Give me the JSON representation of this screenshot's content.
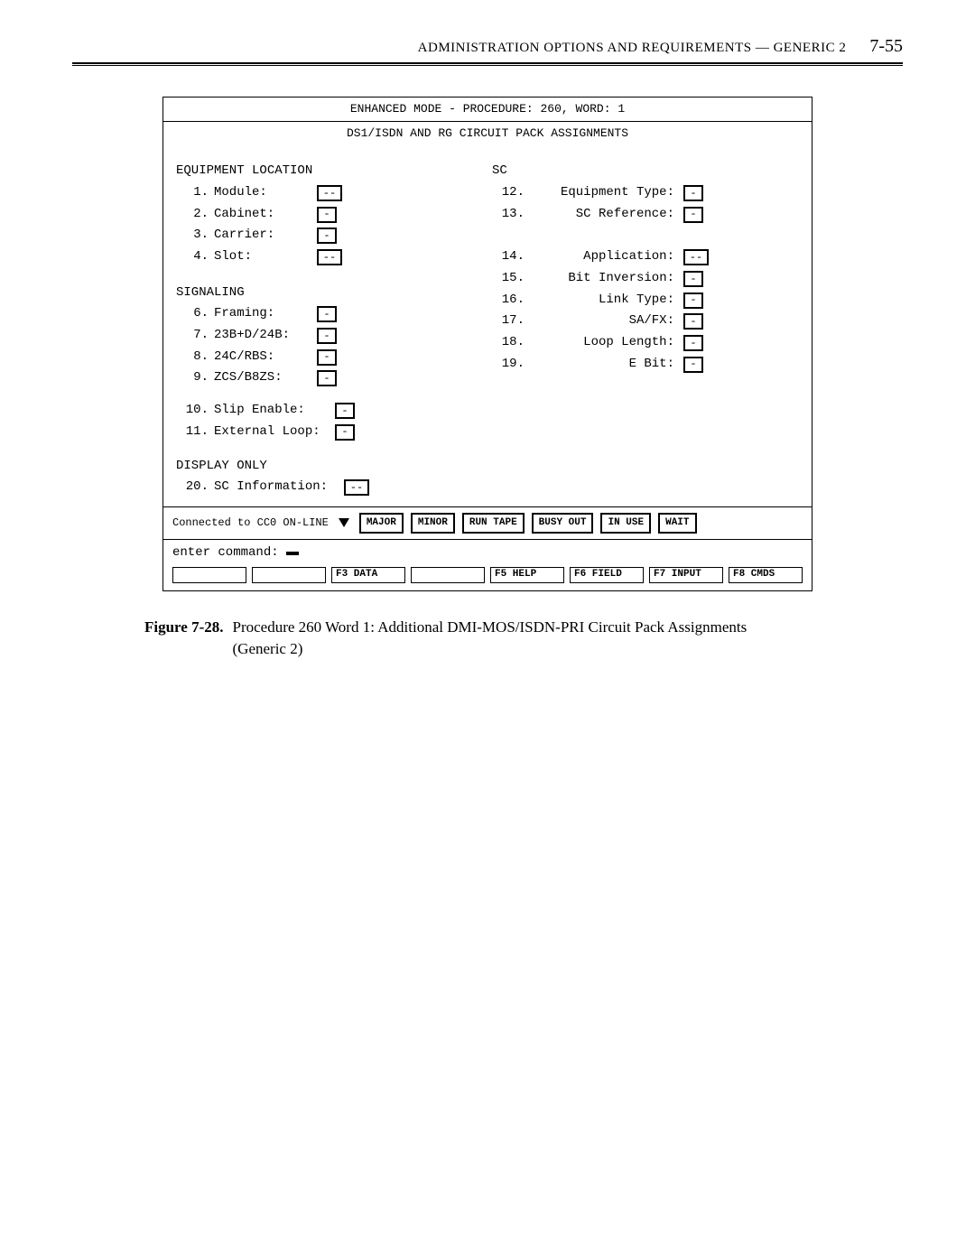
{
  "header": {
    "title": "ADMINISTRATION OPTIONS AND REQUIREMENTS — GENERIC 2",
    "page": "7-55"
  },
  "terminal": {
    "mode_line": "ENHANCED MODE - PROCEDURE: 260, WORD: 1",
    "subtitle": "DS1/ISDN AND RG CIRCUIT PACK ASSIGNMENTS",
    "left": {
      "section1": "EQUIPMENT LOCATION",
      "f1": {
        "n": "1.",
        "l": "Module:",
        "v": "--"
      },
      "f2": {
        "n": "2.",
        "l": "Cabinet:",
        "v": "-"
      },
      "f3": {
        "n": "3.",
        "l": "Carrier:",
        "v": "-"
      },
      "f4": {
        "n": "4.",
        "l": "Slot:",
        "v": "--"
      },
      "section2": "SIGNALING",
      "f6": {
        "n": "6.",
        "l": "Framing:",
        "v": "-"
      },
      "f7": {
        "n": "7.",
        "l": "23B+D/24B:",
        "v": "-"
      },
      "f8": {
        "n": "8.",
        "l": "24C/RBS:",
        "v": "-"
      },
      "f9": {
        "n": "9.",
        "l": "ZCS/B8ZS:",
        "v": "-"
      },
      "f10": {
        "n": "10.",
        "l": "Slip Enable:",
        "v": "-"
      },
      "f11": {
        "n": "11.",
        "l": "External Loop:",
        "v": "-"
      },
      "section3": "DISPLAY ONLY",
      "f20": {
        "n": "20.",
        "l": "SC Information:",
        "v": "--"
      }
    },
    "right": {
      "section": "SC",
      "f12": {
        "n": "12.",
        "l": "Equipment Type:",
        "v": "-"
      },
      "f13": {
        "n": "13.",
        "l": "SC Reference:",
        "v": "-"
      },
      "f14": {
        "n": "14.",
        "l": "Application:",
        "v": "--"
      },
      "f15": {
        "n": "15.",
        "l": "Bit Inversion:",
        "v": "-"
      },
      "f16": {
        "n": "16.",
        "l": "Link Type:",
        "v": "-"
      },
      "f17": {
        "n": "17.",
        "l": "SA/FX:",
        "v": "-"
      },
      "f18": {
        "n": "18.",
        "l": "Loop Length:",
        "v": "-"
      },
      "f19": {
        "n": "19.",
        "l": "E Bit:",
        "v": "-"
      }
    },
    "status": {
      "conn": "Connected to CC0 ON-LINE",
      "b1": "MAJOR",
      "b2": "MINOR",
      "b3": "RUN TAPE",
      "b4": "BUSY OUT",
      "b5": "IN USE",
      "b6": "WAIT"
    },
    "cmd": {
      "prompt": "enter command:",
      "k3": "F3 DATA",
      "k5": "F5 HELP",
      "k6": "F6 FIELD",
      "k7": "F7 INPUT",
      "k8": "F8 CMDS"
    }
  },
  "caption": {
    "label": "Figure 7-28.",
    "text": "Procedure 260 Word 1: Additional DMI-MOS/ISDN-PRI Circuit Pack Assignments",
    "sub": "(Generic 2)"
  }
}
